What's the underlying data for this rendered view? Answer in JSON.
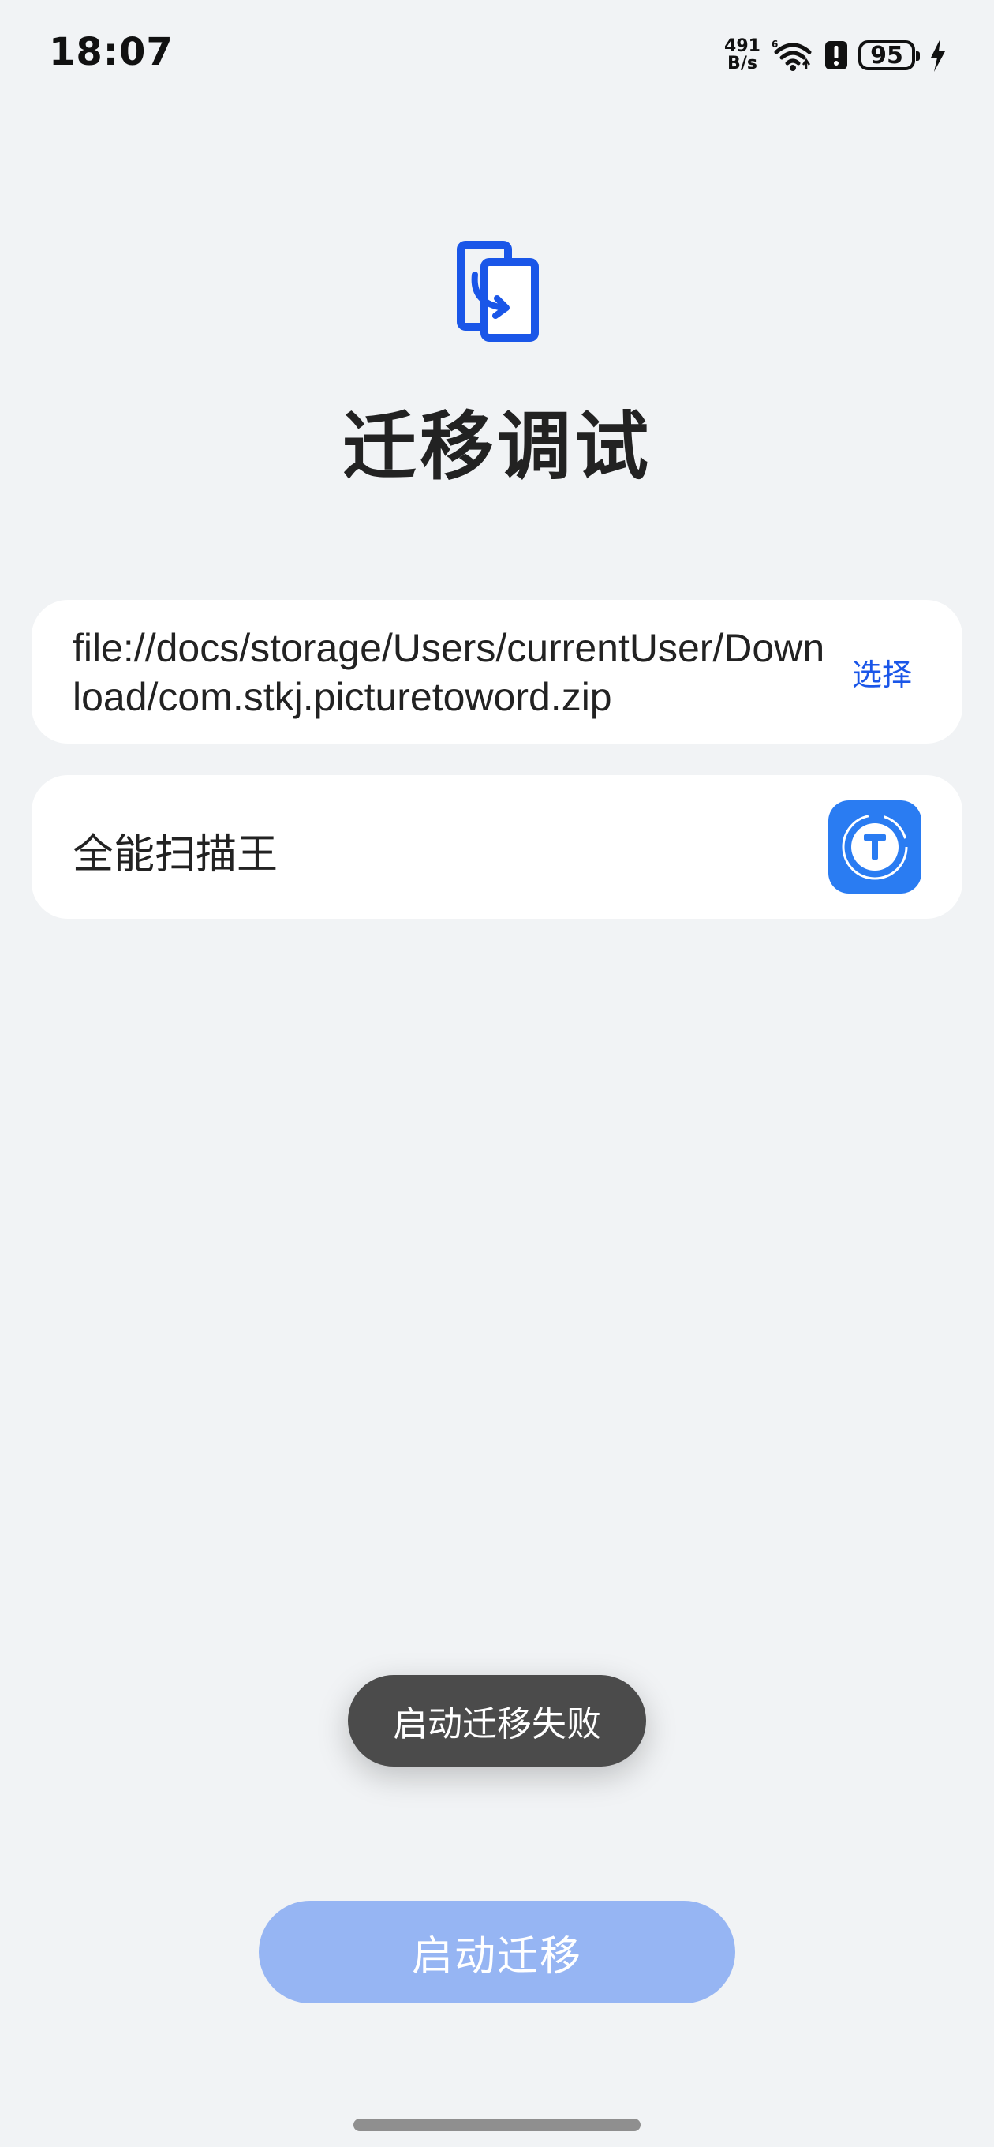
{
  "status_bar": {
    "time": "18:07",
    "net_speed_value": "491",
    "net_speed_unit": "B/s",
    "wifi_icon": "wifi-6-icon",
    "alert_icon": "alert-icon",
    "battery_level": "95",
    "charging_icon": "charging-bolt-icon"
  },
  "header": {
    "logo_icon": "migration-phone-icon",
    "title": "迁移调试"
  },
  "file_card": {
    "path": "file://docs/storage/Users/currentUser/Download/com.stkj.picturetoword.zip",
    "select_label": "选择"
  },
  "app_card": {
    "name": "全能扫描王",
    "icon": "scanner-app-icon"
  },
  "toast": {
    "message": "启动迁移失败"
  },
  "actions": {
    "start_label": "启动迁移"
  },
  "colors": {
    "accent": "#1a56e8",
    "button_disabled": "#96b5f3",
    "background": "#f1f3f5",
    "toast_bg": "#4b4b4b",
    "app_icon_bg": "#2a7cf2"
  }
}
